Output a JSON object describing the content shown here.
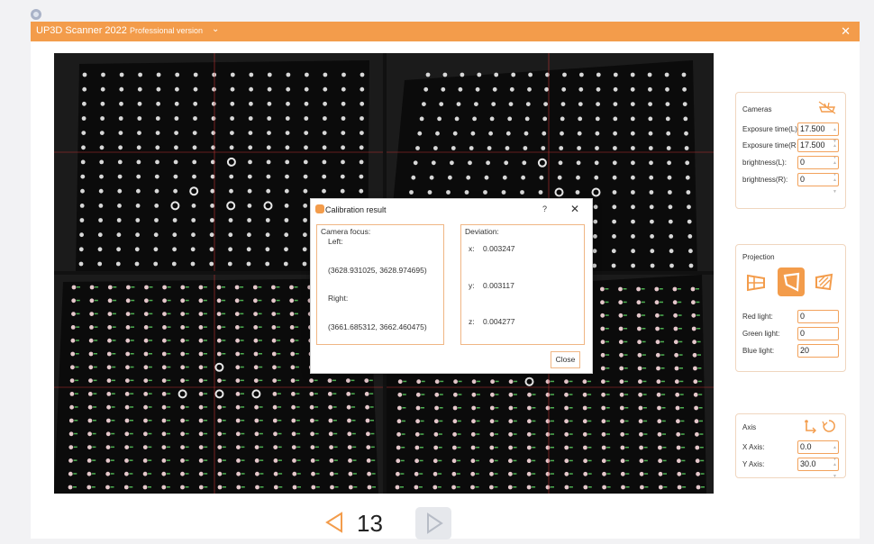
{
  "window": {
    "app_title": "UP3D Scanner 2022",
    "edition": "Professional version",
    "dropdown_glyph": "⌄",
    "close_glyph": "✕"
  },
  "cameras_panel": {
    "title": "Cameras",
    "icon": "camera-off-icon",
    "fields": [
      {
        "label": "Exposure time(L)",
        "value": "17.500"
      },
      {
        "label": "Exposure time(R",
        "value": "17.500"
      },
      {
        "label": "brightness(L):",
        "value": "0"
      },
      {
        "label": "brightness(R):",
        "value": "0"
      }
    ]
  },
  "projection_panel": {
    "title": "Projection",
    "icons": [
      "projection-left-icon",
      "projection-center-icon",
      "projection-right-icon"
    ],
    "fields": [
      {
        "label": "Red light:",
        "value": "0"
      },
      {
        "label": "Green light:",
        "value": "0"
      },
      {
        "label": "Blue light:",
        "value": "20"
      }
    ]
  },
  "axis_panel": {
    "title": "Axis",
    "icons": [
      "axis-move-icon",
      "rotate-icon"
    ],
    "fields": [
      {
        "label": "X  Axis:",
        "value": "0.0"
      },
      {
        "label": "Y  Axis:",
        "value": "30.0"
      }
    ]
  },
  "dialog": {
    "title": "Calibration result",
    "help": "?",
    "close_glyph": "✕",
    "focus_header": "Camera focus:",
    "left_label": "Left:",
    "left_value": "(3628.931025, 3628.974695)",
    "right_label": "Right:",
    "right_value": "(3661.685312, 3662.460475)",
    "deviation_header": "Deviation:",
    "x_label": "x:",
    "x_value": "0.003247",
    "y_label": "y:",
    "y_value": "0.003117",
    "z_label": "z:",
    "z_value": "0.004277",
    "close_label": "Close"
  },
  "pager": {
    "page_number": "13"
  },
  "colors": {
    "accent": "#f39c4b",
    "titlebar": "#f39c4b"
  }
}
